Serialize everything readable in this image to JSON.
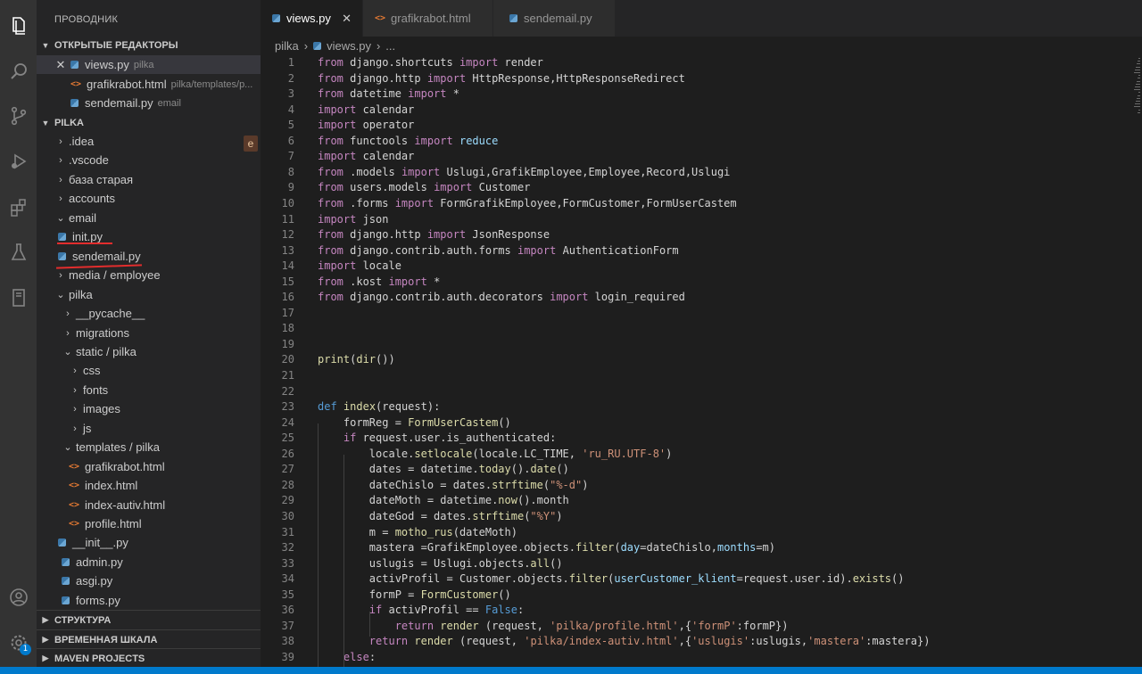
{
  "explorer": {
    "title": "ПРОВОДНИК",
    "open_editors_title": "ОТКРЫТЫЕ РЕДАКТОРЫ",
    "open_editors": [
      {
        "name": "views.py",
        "desc": "pilka",
        "type": "py"
      },
      {
        "name": "grafikrabot.html",
        "desc": "pilka/templates/p...",
        "type": "html"
      },
      {
        "name": "sendemail.py",
        "desc": "email",
        "type": "py"
      }
    ],
    "project_title": "PILKA",
    "badge": "e",
    "tree": [
      {
        "name": ".idea",
        "kind": "folder",
        "open": false
      },
      {
        "name": ".vscode",
        "kind": "folder",
        "open": false
      },
      {
        "name": "база старая",
        "kind": "folder",
        "open": false
      },
      {
        "name": "accounts",
        "kind": "folder",
        "open": false
      },
      {
        "name": "email",
        "kind": "folder",
        "open": true
      },
      {
        "name": "init.py",
        "kind": "py"
      },
      {
        "name": "sendemail.py",
        "kind": "py"
      },
      {
        "name": "media / employee",
        "kind": "folder",
        "open": false
      },
      {
        "name": "pilka",
        "kind": "folder",
        "open": true
      },
      {
        "name": "__pycache__",
        "kind": "folder",
        "open": false
      },
      {
        "name": "migrations",
        "kind": "folder",
        "open": false
      },
      {
        "name": "static / pilka",
        "kind": "folder",
        "open": true
      },
      {
        "name": "css",
        "kind": "folder",
        "open": false
      },
      {
        "name": "fonts",
        "kind": "folder",
        "open": false
      },
      {
        "name": "images",
        "kind": "folder",
        "open": false
      },
      {
        "name": "js",
        "kind": "folder",
        "open": false
      },
      {
        "name": "templates / pilka",
        "kind": "folder",
        "open": true
      },
      {
        "name": "grafikrabot.html",
        "kind": "html"
      },
      {
        "name": "index.html",
        "kind": "html"
      },
      {
        "name": "index-autiv.html",
        "kind": "html"
      },
      {
        "name": "profile.html",
        "kind": "html"
      },
      {
        "name": "__init__.py",
        "kind": "py"
      },
      {
        "name": "admin.py",
        "kind": "py"
      },
      {
        "name": "asgi.py",
        "kind": "py"
      },
      {
        "name": "forms.py",
        "kind": "py"
      }
    ],
    "panels": [
      "СТРУКТУРА",
      "ВРЕМЕННАЯ ШКАЛА",
      "MAVEN PROJECTS"
    ]
  },
  "activity": {
    "icons": [
      "files-icon",
      "search-icon",
      "source-control-icon",
      "run-debug-icon",
      "extensions-icon",
      "testing-icon",
      "book-icon",
      "account-icon",
      "settings-gear-icon"
    ],
    "settings_badge": "1"
  },
  "tabs": [
    {
      "label": "views.py",
      "type": "py",
      "active": true
    },
    {
      "label": "grafikrabot.html",
      "type": "html",
      "active": false
    },
    {
      "label": "sendemail.py",
      "type": "py",
      "active": false
    }
  ],
  "breadcrumb": {
    "folder": "pilka",
    "file": "views.py",
    "more": "..."
  },
  "editor": {
    "line_numbers": [
      "1",
      "2",
      "3",
      "4",
      "5",
      "6",
      "7",
      "8",
      "9",
      "10",
      "11",
      "12",
      "13",
      "14",
      "15",
      "16",
      "17",
      "18",
      "19",
      "20",
      "21",
      "22",
      "23",
      "24",
      "25",
      "26",
      "27",
      "28",
      "29",
      "30",
      "31",
      "32",
      "33",
      "34",
      "35",
      "36",
      "37",
      "38",
      "39"
    ],
    "lines": [
      "from django.shortcuts import render",
      "from django.http import HttpResponse,HttpResponseRedirect",
      "from datetime import *",
      "import calendar",
      "import operator",
      "from functools import reduce",
      "import calendar",
      "from .models import Uslugi,GrafikEmployee,Employee,Record,Uslugi",
      "from users.models import Customer",
      "from .forms import FormGrafikEmployee,FormCustomer,FormUserCastem",
      "import json",
      "from django.http import JsonResponse",
      "from django.contrib.auth.forms import AuthenticationForm",
      "import locale",
      "from .kost import *",
      "from django.contrib.auth.decorators import login_required",
      "",
      "",
      "",
      "print(dir())",
      "",
      "",
      "def index(request):",
      "    formReg = FormUserCastem()",
      "    if request.user.is_authenticated:",
      "        locale.setlocale(locale.LC_TIME, 'ru_RU.UTF-8')",
      "        dates = datetime.today().date()",
      "        dateChislo = dates.strftime(\"%-d\")",
      "        dateMoth = datetime.now().month",
      "        dateGod = dates.strftime(\"%Y\")",
      "        m = motho_rus(dateMoth)",
      "        mastera =GrafikEmployee.objects.filter(day=dateChislo,months=m)",
      "        uslugis = Uslugi.objects.all()",
      "        activProfil = Customer.objects.filter(userCustomer_klient=request.user.id).exists()",
      "        formP = FormCustomer()",
      "        if activProfil == False:",
      "            return render (request, 'pilka/profile.html',{'formP':formP})",
      "        return render (request, 'pilka/index-autiv.html',{'uslugis':uslugis,'mastera':mastera})",
      "    else:"
    ]
  }
}
